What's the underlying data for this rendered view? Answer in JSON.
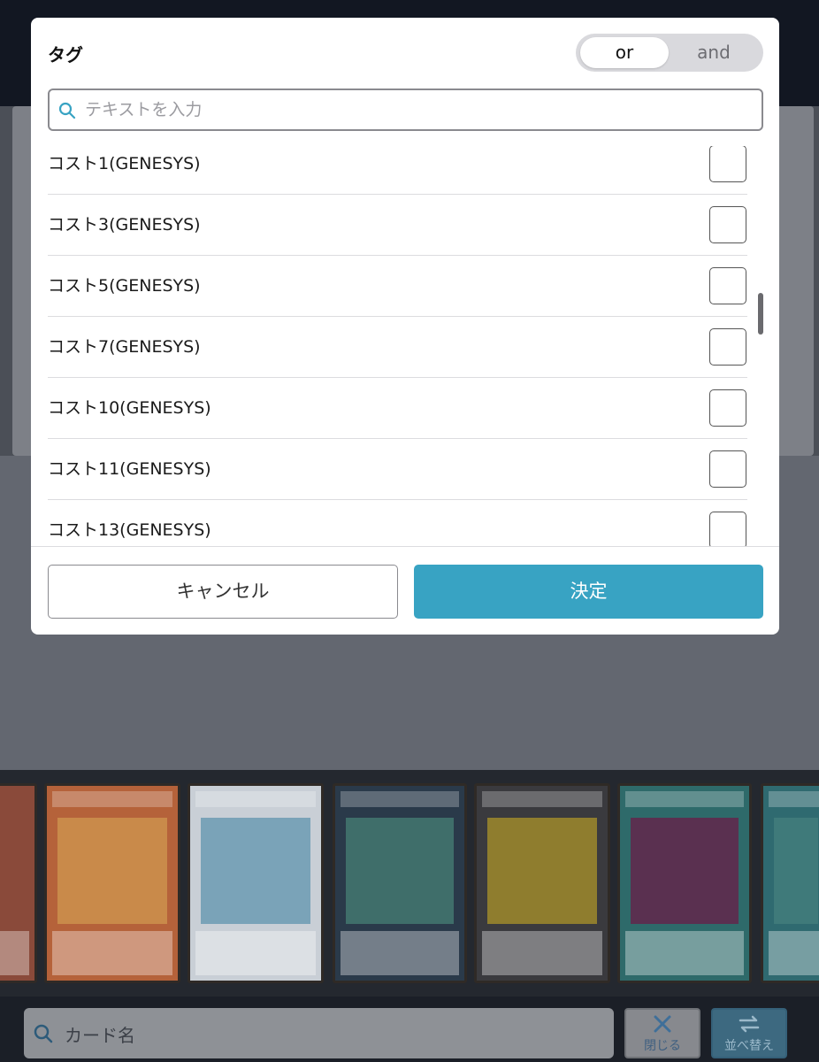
{
  "modal": {
    "title": "タグ",
    "toggle": {
      "or_label": "or",
      "and_label": "and",
      "selected": "or"
    },
    "search": {
      "placeholder": "テキストを入力",
      "value": ""
    },
    "items": [
      {
        "label": "コスト1(GENESYS)",
        "checked": false
      },
      {
        "label": "コスト3(GENESYS)",
        "checked": false
      },
      {
        "label": "コスト5(GENESYS)",
        "checked": false
      },
      {
        "label": "コスト7(GENESYS)",
        "checked": false
      },
      {
        "label": "コスト10(GENESYS)",
        "checked": false
      },
      {
        "label": "コスト11(GENESYS)",
        "checked": false
      },
      {
        "label": "コスト13(GENESYS)",
        "checked": false
      }
    ],
    "cancel_label": "キャンセル",
    "ok_label": "決定"
  },
  "bottom_bar": {
    "search_placeholder": "カード名",
    "close_label": "閉じる",
    "sort_label": "並べ替え"
  },
  "colors": {
    "accent": "#38a3c3",
    "toggle_track": "#d9d9dd",
    "overlay": "#4b4f57"
  }
}
